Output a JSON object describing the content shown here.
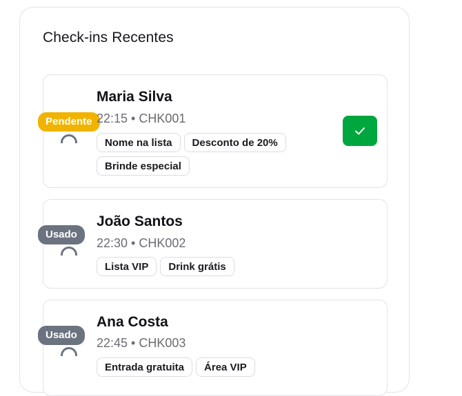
{
  "panel": {
    "title": "Check-ins Recentes"
  },
  "checkins": [
    {
      "name": "Maria Silva",
      "time": "22:15",
      "code": "CHK001",
      "meta": "22:15 • CHK001",
      "status": "Pendente",
      "tags": [
        "Nome na lista",
        "Desconto de 20%",
        "Brinde especial"
      ],
      "action_icon": "check-icon"
    },
    {
      "name": "João Santos",
      "time": "22:30",
      "code": "CHK002",
      "meta": "22:30 • CHK002",
      "status": "Usado",
      "tags": [
        "Lista VIP",
        "Drink grátis"
      ]
    },
    {
      "name": "Ana Costa",
      "time": "22:45",
      "code": "CHK003",
      "meta": "22:45 • CHK003",
      "status": "Usado",
      "tags": [
        "Entrada gratuita",
        "Área VIP"
      ]
    }
  ],
  "colors": {
    "pending": "#f0b400",
    "used": "#6b7280",
    "confirm": "#00a63e",
    "border": "#e3e3e8"
  }
}
